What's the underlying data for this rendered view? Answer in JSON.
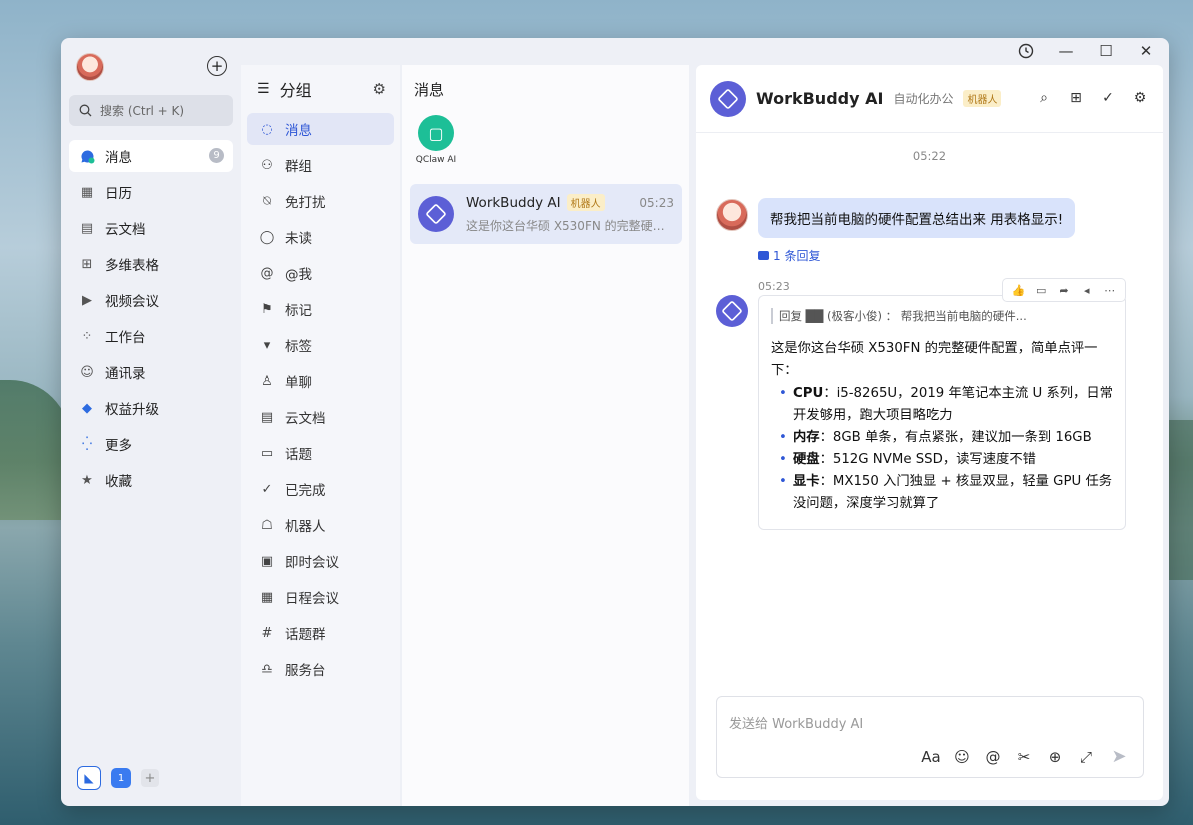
{
  "titlebar": {
    "history_icon": "history-icon",
    "min": "—",
    "max": "☐",
    "close": "✕"
  },
  "nav": {
    "search_placeholder": "搜索 (Ctrl + K)",
    "items": [
      {
        "label": "消息",
        "icon": "message-icon",
        "badge": "9"
      },
      {
        "label": "日历",
        "icon": "calendar-icon"
      },
      {
        "label": "云文档",
        "icon": "doc-icon"
      },
      {
        "label": "多维表格",
        "icon": "table-icon"
      },
      {
        "label": "视频会议",
        "icon": "video-icon"
      },
      {
        "label": "工作台",
        "icon": "apps-icon"
      },
      {
        "label": "通讯录",
        "icon": "contacts-icon"
      },
      {
        "label": "权益升级",
        "icon": "upgrade-icon"
      },
      {
        "label": "更多",
        "icon": "more-icon"
      },
      {
        "label": "收藏",
        "icon": "star-icon"
      }
    ],
    "bottom_badge": "1"
  },
  "groups": {
    "title": "分组",
    "items": [
      {
        "label": "消息"
      },
      {
        "label": "群组"
      },
      {
        "label": "免打扰"
      },
      {
        "label": "未读"
      },
      {
        "label": "@我"
      },
      {
        "label": "标记"
      },
      {
        "label": "标签"
      },
      {
        "label": "单聊"
      },
      {
        "label": "云文档"
      },
      {
        "label": "话题"
      },
      {
        "label": "已完成"
      },
      {
        "label": "机器人"
      },
      {
        "label": "即时会议"
      },
      {
        "label": "日程会议"
      },
      {
        "label": "话题群"
      },
      {
        "label": "服务台"
      }
    ]
  },
  "messages": {
    "title": "消息",
    "pinned": {
      "label": "QClaw AI"
    },
    "conversation": {
      "name": "WorkBuddy AI",
      "tag": "机器人",
      "time": "05:23",
      "preview": "这是你这台华硕 X530FN 的完整硬件..."
    }
  },
  "chat": {
    "name": "WorkBuddy AI",
    "sub": "自动化办公",
    "tag": "机器人",
    "timestamp": "05:22",
    "user_message": "帮我把当前电脑的硬件配置总结出来 用表格显示!",
    "reply_count": "1 条回复",
    "bot_time": "05:23",
    "quote": "回复 ██ (极客小俊) ： 帮我把当前电脑的硬件...",
    "intro": "这是你这台华硕 X530FN 的完整硬件配置，简单点评一下：",
    "specs": [
      {
        "k": "CPU",
        "v": "：i5-8265U，2019 年笔记本主流 U 系列，日常开发够用，跑大项目略吃力"
      },
      {
        "k": "内存",
        "v": "：8GB 单条，有点紧张，建议加一条到 16GB"
      },
      {
        "k": "硬盘",
        "v": "：512G NVMe SSD，读写速度不错"
      },
      {
        "k": "显卡",
        "v": "：MX150 入门独显 + 核显双显，轻量 GPU 任务没问题，深度学习就算了"
      }
    ],
    "composer_placeholder": "发送给 WorkBuddy AI"
  }
}
